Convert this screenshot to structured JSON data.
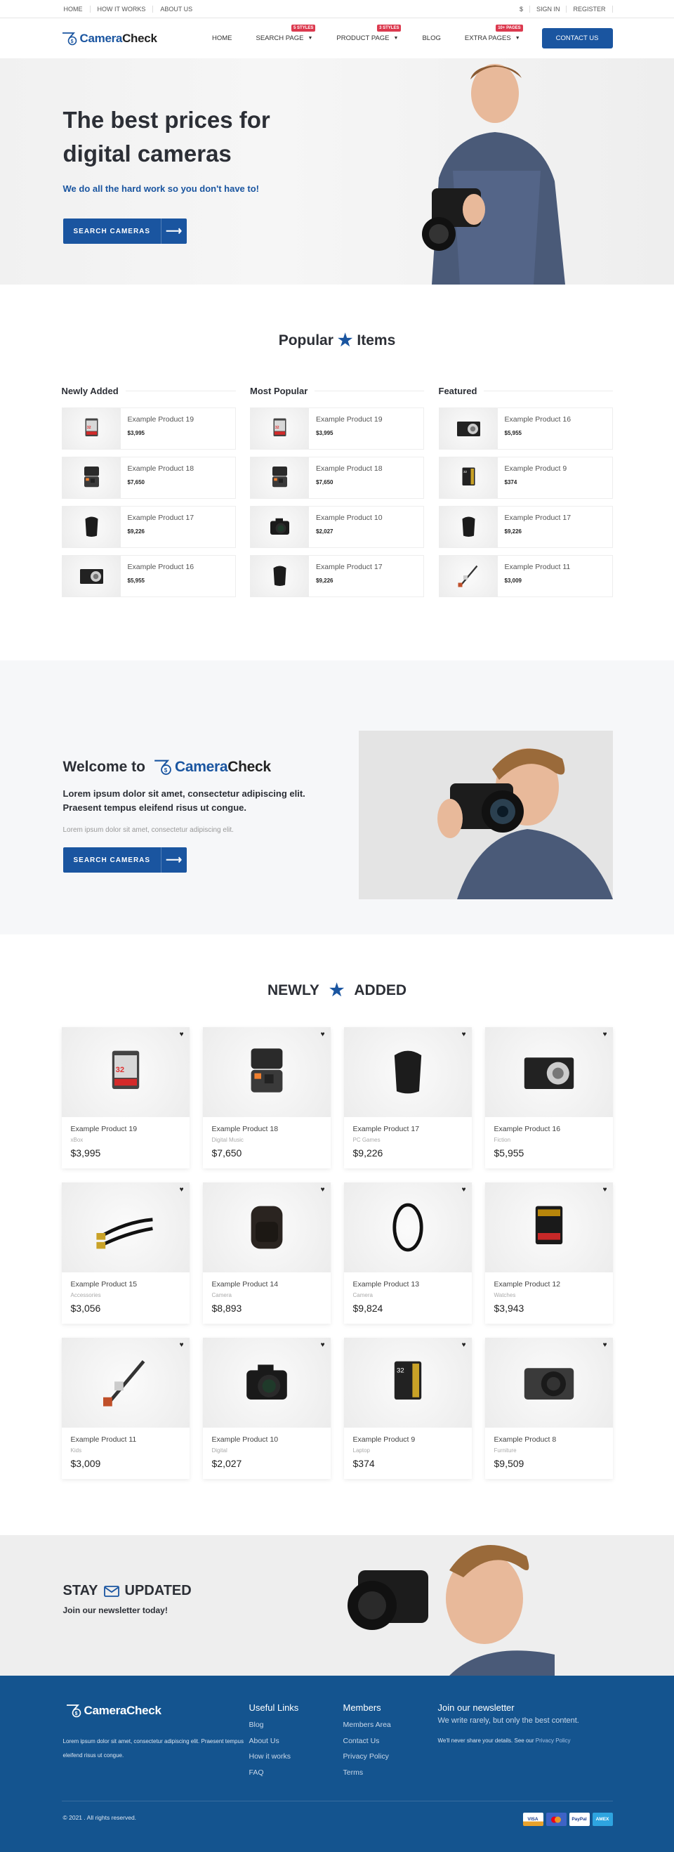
{
  "topbar": {
    "left_links": [
      "HOME",
      "HOW IT WORKS",
      "ABOUT US"
    ],
    "right_links": [
      "$",
      "SIGN IN",
      "REGISTER"
    ]
  },
  "header": {
    "logo": {
      "part1": "Camera",
      "part2": "Check"
    },
    "nav": [
      {
        "label": "HOME",
        "badge": null,
        "dropdown": false
      },
      {
        "label": "SEARCH PAGE",
        "badge": "5 STYLES",
        "dropdown": true
      },
      {
        "label": "PRODUCT PAGE",
        "badge": "3 STYLES",
        "dropdown": true
      },
      {
        "label": "BLOG",
        "badge": null,
        "dropdown": false
      },
      {
        "label": "EXTRA PAGES",
        "badge": "10+ PAGES",
        "dropdown": true
      }
    ],
    "contact_label": "CONTACT US"
  },
  "hero": {
    "title": "The best prices for digital cameras",
    "subtitle": "We do all the hard work so you don't have to!",
    "button_label": "SEARCH CAMERAS",
    "button_arrow": "⟶"
  },
  "popular": {
    "title_left": "Popular",
    "title_right": "Items",
    "columns": [
      {
        "title": "Newly Added",
        "items": [
          {
            "name": "Example Product 19",
            "price": "$3,995",
            "img": "sd-card"
          },
          {
            "name": "Example Product 18",
            "price": "$7,650",
            "img": "case"
          },
          {
            "name": "Example Product 17",
            "price": "$9,226",
            "img": "bag"
          },
          {
            "name": "Example Product 16",
            "price": "$5,955",
            "img": "compact"
          }
        ]
      },
      {
        "title": "Most Popular",
        "items": [
          {
            "name": "Example Product 19",
            "price": "$3,995",
            "img": "sd-card"
          },
          {
            "name": "Example Product 18",
            "price": "$7,650",
            "img": "case"
          },
          {
            "name": "Example Product 10",
            "price": "$2,027",
            "img": "dslr"
          },
          {
            "name": "Example Product 17",
            "price": "$9,226",
            "img": "bag"
          }
        ]
      },
      {
        "title": "Featured",
        "items": [
          {
            "name": "Example Product 16",
            "price": "$5,955",
            "img": "compact"
          },
          {
            "name": "Example Product 9",
            "price": "$374",
            "img": "sd-gold"
          },
          {
            "name": "Example Product 17",
            "price": "$9,226",
            "img": "bag"
          },
          {
            "name": "Example Product 11",
            "price": "$3,009",
            "img": "stick"
          }
        ]
      }
    ]
  },
  "welcome": {
    "title": "Welcome to",
    "lead": "Lorem ipsum dolor sit amet, consectetur adipiscing elit. Praesent tempus eleifend risus ut congue.",
    "small": "Lorem ipsum dolor sit amet, consectetur adipiscing elit.",
    "button_label": "SEARCH CAMERAS",
    "button_arrow": "⟶"
  },
  "newly": {
    "title_left": "NEWLY",
    "title_right": "ADDED",
    "products": [
      {
        "name": "Example Product 19",
        "category": "xBox",
        "price": "$3,995",
        "img": "sd-card"
      },
      {
        "name": "Example Product 18",
        "category": "Digital Music",
        "price": "$7,650",
        "img": "case"
      },
      {
        "name": "Example Product 17",
        "category": "PC Games",
        "price": "$9,226",
        "img": "bag"
      },
      {
        "name": "Example Product 16",
        "category": "Fiction",
        "price": "$5,955",
        "img": "compact"
      },
      {
        "name": "Example Product 15",
        "category": "Accessories",
        "price": "$3,056",
        "img": "cable"
      },
      {
        "name": "Example Product 14",
        "category": "Camera",
        "price": "$8,893",
        "img": "backpack"
      },
      {
        "name": "Example Product 13",
        "category": "Camera",
        "price": "$9,824",
        "img": "filter"
      },
      {
        "name": "Example Product 12",
        "category": "Watches",
        "price": "$3,943",
        "img": "sd-black"
      },
      {
        "name": "Example Product 11",
        "category": "Kids",
        "price": "$3,009",
        "img": "stick"
      },
      {
        "name": "Example Product 10",
        "category": "Digital",
        "price": "$2,027",
        "img": "dslr"
      },
      {
        "name": "Example Product 9",
        "category": "Laptop",
        "price": "$374",
        "img": "sd-gold"
      },
      {
        "name": "Example Product 8",
        "category": "Furniture",
        "price": "$9,509",
        "img": "compact2"
      }
    ]
  },
  "stay": {
    "title_left": "STAY",
    "title_right": "UPDATED",
    "subtitle": "Join our newsletter today!"
  },
  "footer": {
    "about": "Lorem ipsum dolor sit amet, consectetur adipiscing elit. Praesent tempus eleifend risus ut congue.",
    "useful": {
      "title": "Useful Links",
      "links": [
        "Blog",
        "About Us",
        "How it works",
        "FAQ"
      ]
    },
    "members": {
      "title": "Members",
      "links": [
        "Members Area",
        "Contact Us",
        "Privacy Policy",
        "Terms"
      ]
    },
    "newsletter": {
      "title": "Join our newsletter",
      "text": "We write rarely, but only the best content.",
      "note": "We'll never share your details. See our",
      "note_link": "Privacy Policy"
    },
    "copyright": "© 2021 . All rights reserved.",
    "payments": [
      "VISA",
      "mastercard",
      "PayPal",
      "AMEX"
    ]
  },
  "colors": {
    "brand": "#1a55a0",
    "footer_bg": "#14548f",
    "badge": "#dc3a4f",
    "text_dark": "#2c2f36"
  }
}
